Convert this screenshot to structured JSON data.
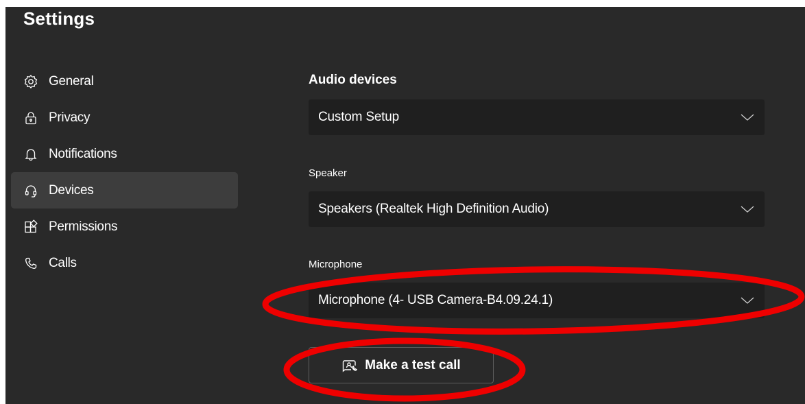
{
  "header": {
    "title": "Settings"
  },
  "nav": {
    "items": [
      {
        "label": "General",
        "icon": "gear-icon",
        "active": false
      },
      {
        "label": "Privacy",
        "icon": "lock-icon",
        "active": false
      },
      {
        "label": "Notifications",
        "icon": "bell-icon",
        "active": false
      },
      {
        "label": "Devices",
        "icon": "headset-icon",
        "active": true
      },
      {
        "label": "Permissions",
        "icon": "apps-icon",
        "active": false
      },
      {
        "label": "Calls",
        "icon": "phone-icon",
        "active": false
      }
    ]
  },
  "devices": {
    "section_title": "Audio devices",
    "audio_device": {
      "value": "Custom Setup"
    },
    "speaker": {
      "label": "Speaker",
      "value": "Speakers (Realtek High Definition Audio)"
    },
    "microphone": {
      "label": "Microphone",
      "value": "Microphone (4- USB Camera-B4.09.24.1)"
    },
    "test_call": {
      "label": "Make a test call",
      "icon": "test-call-icon"
    }
  },
  "colors": {
    "background": "#292929",
    "dropdown": "#1f1f1f",
    "nav_active": "#3d3d3d",
    "annotation_red": "#ee0000"
  }
}
